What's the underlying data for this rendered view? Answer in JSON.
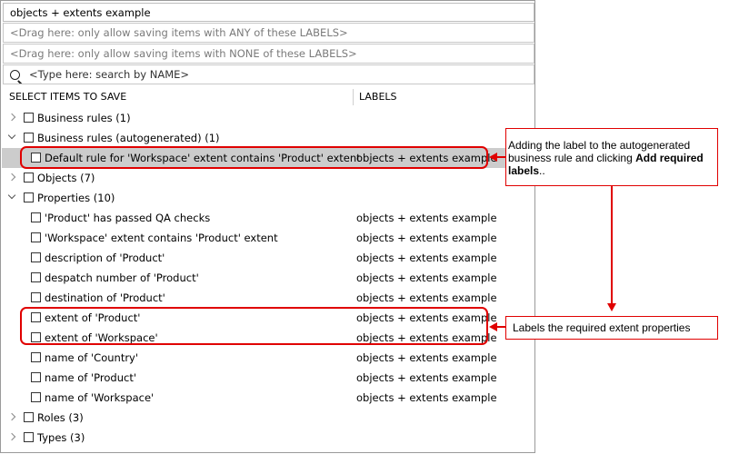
{
  "title_field": {
    "value": "objects + extents example"
  },
  "any_labels_drop": {
    "placeholder": "<Drag here: only allow saving items with ANY of these LABELS>"
  },
  "none_labels_drop": {
    "placeholder": "<Drag here: only allow saving items with NONE of these LABELS>"
  },
  "search": {
    "placeholder": "<Type here: search by NAME>",
    "icon": "search-icon"
  },
  "columns": {
    "items": "SELECT ITEMS TO SAVE",
    "labels": "LABELS"
  },
  "tree": [
    {
      "label": "Business rules (1)",
      "label2": "",
      "level": 0,
      "chevron": "right",
      "selected": false
    },
    {
      "label": "Business rules (autogenerated) (1)",
      "label2": "",
      "level": 0,
      "chevron": "down",
      "selected": false
    },
    {
      "label": "Default rule for 'Workspace' extent contains 'Product' extent",
      "label2": "objects + extents example",
      "level": 1,
      "chevron": "",
      "selected": true
    },
    {
      "label": "Objects (7)",
      "label2": "",
      "level": 0,
      "chevron": "right",
      "selected": false
    },
    {
      "label": "Properties (10)",
      "label2": "",
      "level": 0,
      "chevron": "down",
      "selected": false
    },
    {
      "label": "'Product' has passed QA checks",
      "label2": "objects + extents example",
      "level": 1,
      "chevron": "",
      "selected": false
    },
    {
      "label": "'Workspace' extent contains 'Product' extent",
      "label2": "objects + extents example",
      "level": 1,
      "chevron": "",
      "selected": false
    },
    {
      "label": "description of 'Product'",
      "label2": "objects + extents example",
      "level": 1,
      "chevron": "",
      "selected": false
    },
    {
      "label": "despatch number of 'Product'",
      "label2": "objects + extents example",
      "level": 1,
      "chevron": "",
      "selected": false
    },
    {
      "label": "destination of 'Product'",
      "label2": "objects + extents example",
      "level": 1,
      "chevron": "",
      "selected": false
    },
    {
      "label": "extent of 'Product'",
      "label2": "objects + extents example",
      "level": 1,
      "chevron": "",
      "selected": false
    },
    {
      "label": "extent of 'Workspace'",
      "label2": "objects + extents example",
      "level": 1,
      "chevron": "",
      "selected": false
    },
    {
      "label": "name of 'Country'",
      "label2": "objects + extents example",
      "level": 1,
      "chevron": "",
      "selected": false
    },
    {
      "label": "name of 'Product'",
      "label2": "objects + extents example",
      "level": 1,
      "chevron": "",
      "selected": false
    },
    {
      "label": "name of 'Workspace'",
      "label2": "objects + extents example",
      "level": 1,
      "chevron": "",
      "selected": false
    },
    {
      "label": "Roles (3)",
      "label2": "",
      "level": 0,
      "chevron": "right",
      "selected": false
    },
    {
      "label": "Types (3)",
      "label2": "",
      "level": 0,
      "chevron": "right",
      "selected": false
    }
  ],
  "annotations": {
    "note1": {
      "text_before": "Adding the label to the autogenerated business rule and clicking ",
      "bold": "Add required labels",
      "text_after": ".."
    },
    "note2": {
      "text": "Labels the required extent properties"
    },
    "color": "#e00000"
  }
}
